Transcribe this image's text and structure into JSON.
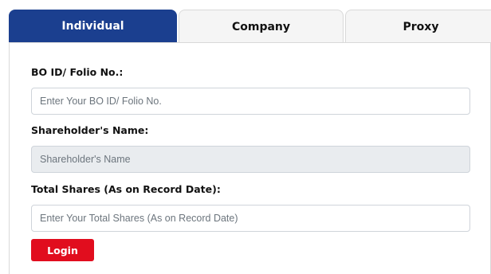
{
  "tabs": [
    {
      "label": "Individual",
      "active": true
    },
    {
      "label": "Company",
      "active": false
    },
    {
      "label": "Proxy",
      "active": false
    }
  ],
  "form": {
    "bo_id": {
      "label": "BO ID/ Folio No.:",
      "placeholder": "Enter Your BO ID/ Folio No.",
      "value": ""
    },
    "shareholder_name": {
      "label": "Shareholder's Name:",
      "placeholder": "Shareholder's Name",
      "value": "",
      "disabled": true
    },
    "total_shares": {
      "label": "Total Shares (As on Record Date):",
      "placeholder": "Enter Your Total Shares (As on Record Date)",
      "value": ""
    },
    "login_label": "Login"
  },
  "colors": {
    "tab_active": "#1b3f8f",
    "login_button": "#e10d1e",
    "disabled_field": "#e9ecef"
  }
}
